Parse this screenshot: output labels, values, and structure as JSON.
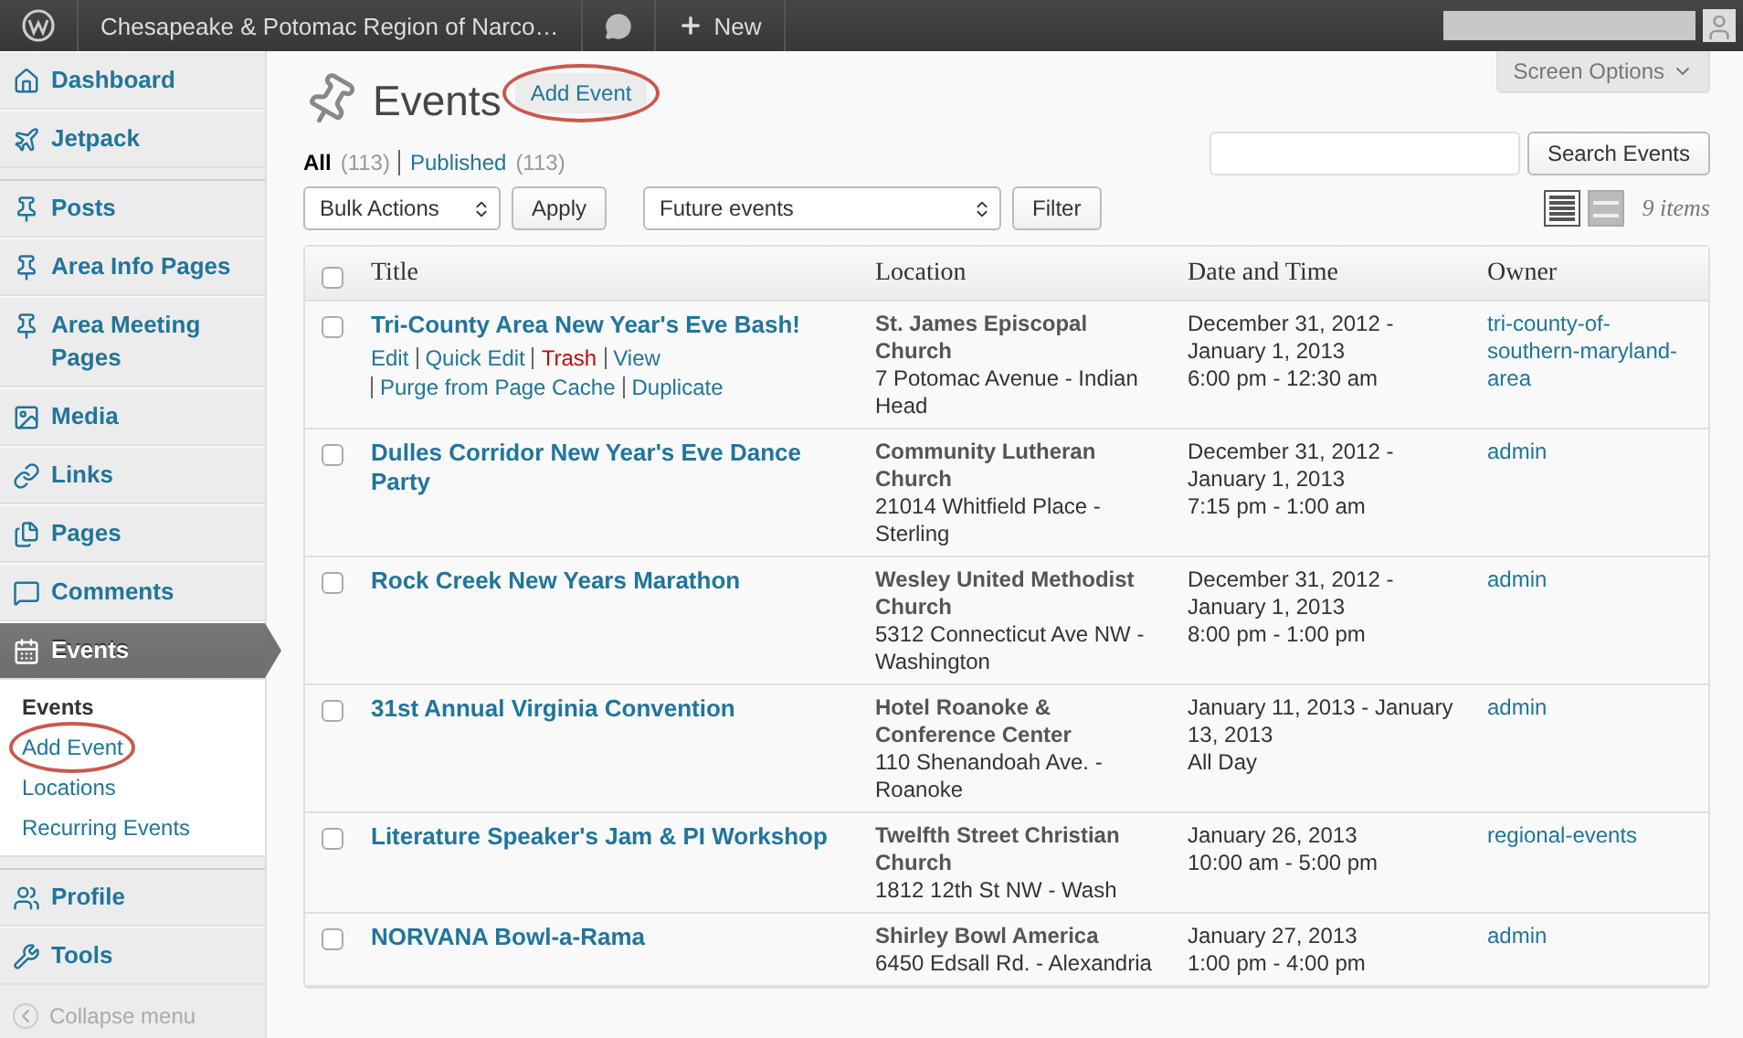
{
  "admin_bar": {
    "site_title": "Chesapeake & Potomac Region of Narco…",
    "new_label": "New"
  },
  "screen_options": {
    "label": "Screen Options"
  },
  "sidebar": {
    "items": [
      {
        "label": "Dashboard",
        "current": false,
        "group_start": false
      },
      {
        "label": "Jetpack",
        "current": false,
        "group_start": false
      },
      {
        "label": "Posts",
        "current": false,
        "group_start": true
      },
      {
        "label": "Area Info Pages",
        "current": false,
        "group_start": false
      },
      {
        "label": "Area Meeting Pages",
        "current": false,
        "group_start": false
      },
      {
        "label": "Media",
        "current": false,
        "group_start": false
      },
      {
        "label": "Links",
        "current": false,
        "group_start": false
      },
      {
        "label": "Pages",
        "current": false,
        "group_start": false
      },
      {
        "label": "Comments",
        "current": false,
        "group_start": false
      },
      {
        "label": "Events",
        "current": true,
        "group_start": false,
        "submenu": [
          {
            "label": "Events",
            "selected": true,
            "circled": false
          },
          {
            "label": "Add Event",
            "selected": false,
            "circled": true
          },
          {
            "label": "Locations",
            "selected": false,
            "circled": false
          },
          {
            "label": "Recurring Events",
            "selected": false,
            "circled": false
          }
        ]
      },
      {
        "label": "Profile",
        "current": false,
        "group_start": true
      },
      {
        "label": "Tools",
        "current": false,
        "group_start": false
      }
    ],
    "collapse_label": "Collapse menu"
  },
  "page": {
    "title": "Events",
    "add_button": {
      "label": "Add Event",
      "circled": true
    },
    "views": [
      {
        "label": "All",
        "count": "(113)",
        "selected": true
      },
      {
        "label": "Published",
        "count": "(113)",
        "selected": false
      }
    ],
    "search_button": "Search Events",
    "bulk_select": "Bulk Actions",
    "apply_button": "Apply",
    "scope_select": "Future events",
    "filter_button": "Filter",
    "view_modes": [
      {
        "kind": "list",
        "selected": true
      },
      {
        "kind": "excerpt",
        "selected": false
      }
    ],
    "item_count": "9 items"
  },
  "table": {
    "select_all_checked": false,
    "columns": [
      "Title",
      "Location",
      "Date and Time",
      "Owner"
    ],
    "rows": [
      {
        "checked": false,
        "title": "Tri-County Area New Year's Eve Bash!",
        "actions": [
          {
            "label": "Edit",
            "kind": "link"
          },
          {
            "label": "Quick Edit",
            "kind": "link"
          },
          {
            "label": "Trash",
            "kind": "delete"
          },
          {
            "label": "View",
            "kind": "link"
          },
          {
            "label": "Purge from Page Cache",
            "kind": "link"
          },
          {
            "label": "Duplicate",
            "kind": "link"
          }
        ],
        "location_name": "St. James Episcopal Church",
        "location_address": "7 Potomac Avenue - Indian Head",
        "date": "December 31, 2012 - January 1, 2013",
        "time": "6:00 pm - 12:30 am",
        "owner": "tri-county-of-southern-maryland-area"
      },
      {
        "checked": false,
        "title": "Dulles Corridor New Year's Eve Dance Party",
        "location_name": "Community Lutheran Church",
        "location_address": "21014 Whitfield Place - Sterling",
        "date": "December 31, 2012 - January 1, 2013",
        "time": "7:15 pm - 1:00 am",
        "owner": "admin"
      },
      {
        "checked": false,
        "title": "Rock Creek New Years Marathon",
        "location_name": "Wesley United Methodist Church",
        "location_address": "5312 Connecticut Ave NW - Washington",
        "date": "December 31, 2012 - January 1, 2013",
        "time": "8:00 pm - 1:00 pm",
        "owner": "admin"
      },
      {
        "checked": false,
        "title": "31st Annual Virginia Convention",
        "location_name": "Hotel Roanoke & Conference Center",
        "location_address": "110 Shenandoah Ave. - Roanoke",
        "date": "January 11, 2013 - January 13, 2013",
        "time": "All Day",
        "owner": "admin"
      },
      {
        "checked": false,
        "title": "Literature Speaker's Jam & PI Workshop",
        "location_name": "Twelfth Street Christian Church",
        "location_address": "1812 12th St NW - Wash",
        "date": "January 26, 2013",
        "time": "10:00 am - 5:00 pm",
        "owner": "regional-events"
      },
      {
        "checked": false,
        "title": "NORVANA Bowl-a-Rama",
        "location_name": "Shirley Bowl America",
        "location_address": "6450 Edsall Rd. - Alexandria",
        "date": "January 27, 2013",
        "time": "1:00 pm - 4:00 pm",
        "owner": "admin"
      }
    ]
  }
}
